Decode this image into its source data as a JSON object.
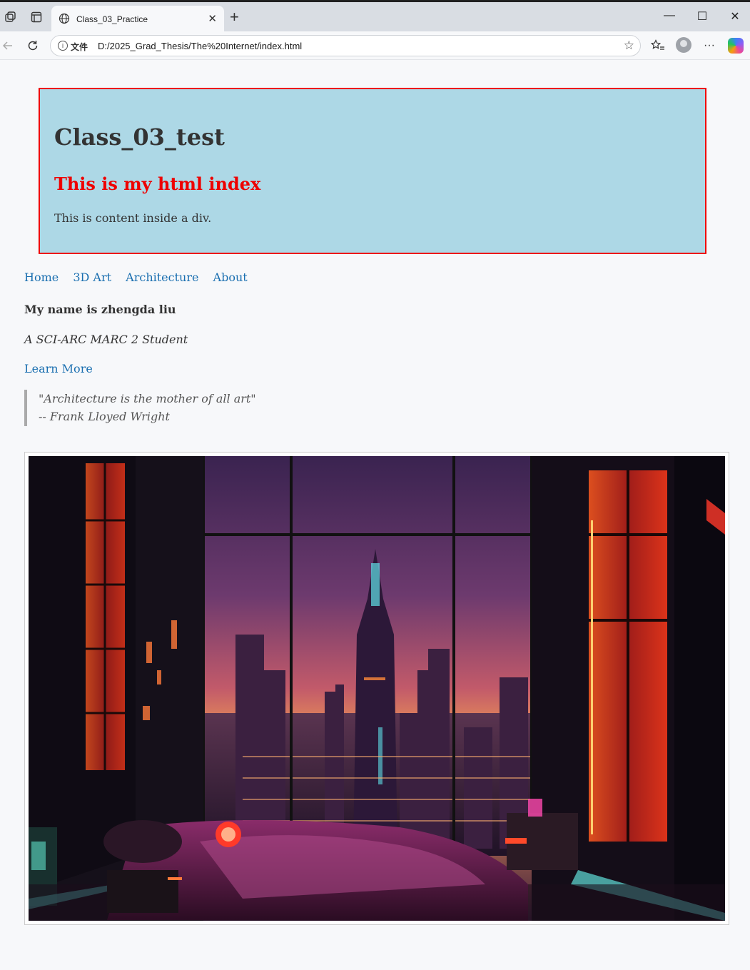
{
  "browser": {
    "tab_title": "Class_03_Practice",
    "tab_close": "✕",
    "new_tab": "+",
    "address_badge": "文件",
    "url": "D:/2025_Grad_Thesis/The%20Internet/index.html",
    "window_controls": {
      "minimize": "—",
      "maximize": "☐",
      "close": "✕"
    },
    "toolbar_more": "···"
  },
  "hero": {
    "title": "Class_03_test",
    "subtitle": "This is my html index",
    "content": "This is content inside a div.",
    "background": "#add8e6",
    "border_color": "#ee0000",
    "subtitle_color": "#ee0000"
  },
  "nav": {
    "links": [
      "Home",
      "3D Art",
      "Architecture",
      "About"
    ],
    "link_color": "#1a6fb0"
  },
  "profile": {
    "name": "My name is zhengda liu",
    "role": "A SCI-ARC MARC 2 Student",
    "learn_more": "Learn More"
  },
  "quote": {
    "text": "\"Architecture is the mother of all art\"",
    "author": "-- Frank Lloyed Wright"
  },
  "image": {
    "description_icon": "cyberpunk-bedroom-city-view-image"
  }
}
